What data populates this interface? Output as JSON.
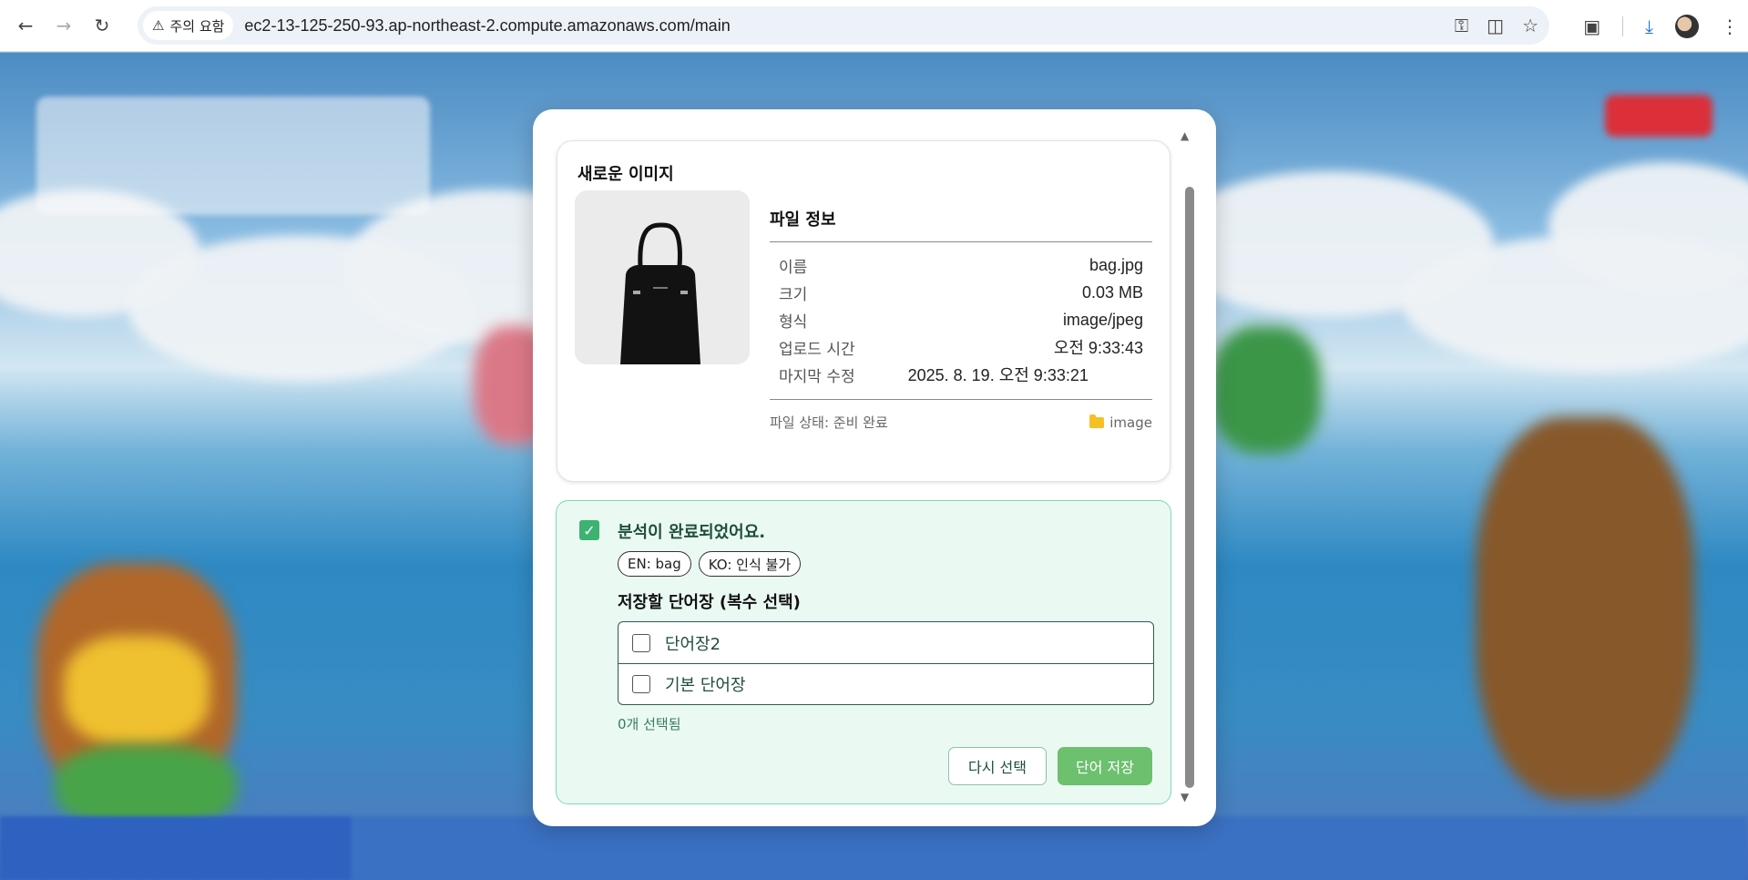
{
  "browser": {
    "security_chip": "주의 요함",
    "url": "ec2-13-125-250-93.ap-northeast-2.compute.amazonaws.com/main"
  },
  "file_card": {
    "title": "새로운 이미지",
    "info_title": "파일 정보",
    "rows": [
      {
        "label": "이름",
        "value": "bag.jpg"
      },
      {
        "label": "크기",
        "value": "0.03 MB"
      },
      {
        "label": "형식",
        "value": "image/jpeg"
      },
      {
        "label": "업로드 시간",
        "value": "오전 9:33:43"
      },
      {
        "label": "마지막 수정",
        "value": "2025. 8. 19. 오전 9:33:21"
      }
    ],
    "status": "파일 상태: 준비 완료",
    "folder": "image"
  },
  "result": {
    "title": "분석이 완료되었어요.",
    "tags": [
      "EN: bag",
      "KO: 인식 불가"
    ],
    "save_title": "저장할 단어장 (복수 선택)",
    "wordbooks": [
      {
        "label": "단어장2",
        "checked": false
      },
      {
        "label": "기본 단어장",
        "checked": false
      }
    ],
    "selected_count": "0개 선택됨",
    "reselect_label": "다시 선택",
    "save_label": "단어 저장"
  },
  "colors": {
    "accent": "#6cc06e",
    "result_bg": "#eafaf3"
  }
}
